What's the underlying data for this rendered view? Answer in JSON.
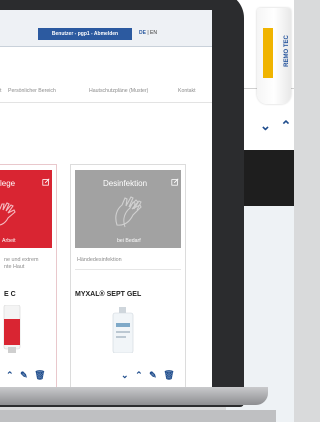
{
  "header": {
    "user_bar": "Benutzer - pgp1 - Abmelden",
    "lang_active": "DE",
    "lang_sep": "|",
    "lang_other": "EN"
  },
  "nav": {
    "items": [
      "t",
      "Persönlicher Bereich",
      "Hautschutzpläne (Muster)",
      "Kontakt"
    ]
  },
  "cards": [
    {
      "head_title": "lege",
      "head_sub": "Arbeit",
      "head_color": "#d92532",
      "category": "...ne und extrem\n...nte Haut",
      "product": "E C"
    },
    {
      "head_title": "Desinfektion",
      "head_sub": "bei Bedarf",
      "head_color": "#a2a2a2",
      "category": "Händedesinfektion",
      "product": "MYXAL® SEPT GEL"
    }
  ],
  "background_product": {
    "label": "REMO TEC"
  },
  "icons": [
    "chevron-down-icon",
    "chevron-up-icon",
    "pencil-icon",
    "trash-icon",
    "edit-icon",
    "gloves-icon"
  ],
  "colors": {
    "accent_blue": "#2c5aa0",
    "action_blue": "#1e4c8c",
    "care_red": "#d92532",
    "disinfection_grey": "#a2a2a2"
  }
}
